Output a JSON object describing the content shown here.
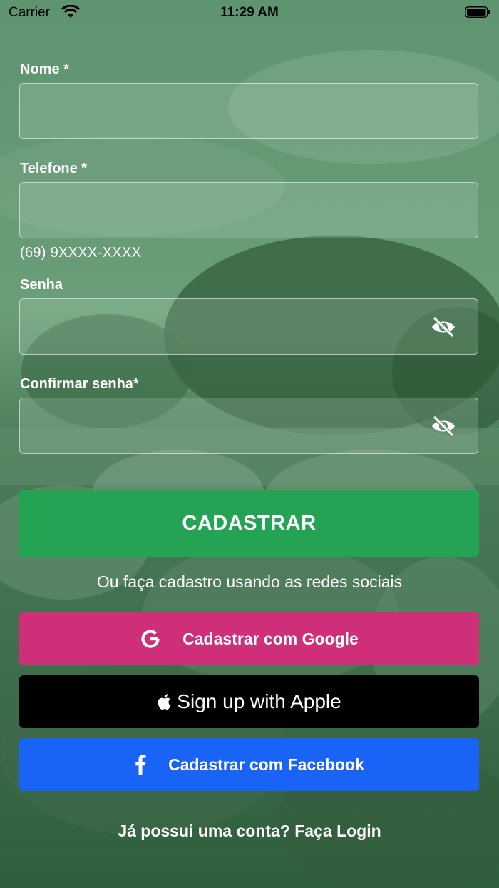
{
  "status_bar": {
    "carrier": "Carrier",
    "time": "11:29 AM"
  },
  "form": {
    "nome_label": "Nome *",
    "telefone_label": "Telefone *",
    "telefone_hint": "(69) 9XXXX-XXXX",
    "senha_label": "Senha",
    "confirmar_label": "Confirmar senha*",
    "nome_value": "",
    "telefone_value": "",
    "senha_value": "",
    "confirmar_value": ""
  },
  "actions": {
    "register_label": "CADASTRAR",
    "social_prompt": "Ou faça cadastro usando as redes sociais",
    "google_label": "Cadastrar com Google",
    "apple_label": "Sign up with Apple",
    "facebook_label": "Cadastrar com Facebook",
    "login_link": "Já possui uma conta? Faça Login"
  },
  "icons": {
    "google": "google-g-icon",
    "apple": "apple-logo-icon",
    "facebook": "facebook-f-icon",
    "password_toggle": "eye-slash-icon",
    "wifi": "wifi-icon",
    "battery": "battery-icon"
  },
  "colors": {
    "primary_green": "#24a354",
    "google_pink": "#cf2e79",
    "apple_black": "#000000",
    "facebook_blue": "#1a63f7"
  }
}
